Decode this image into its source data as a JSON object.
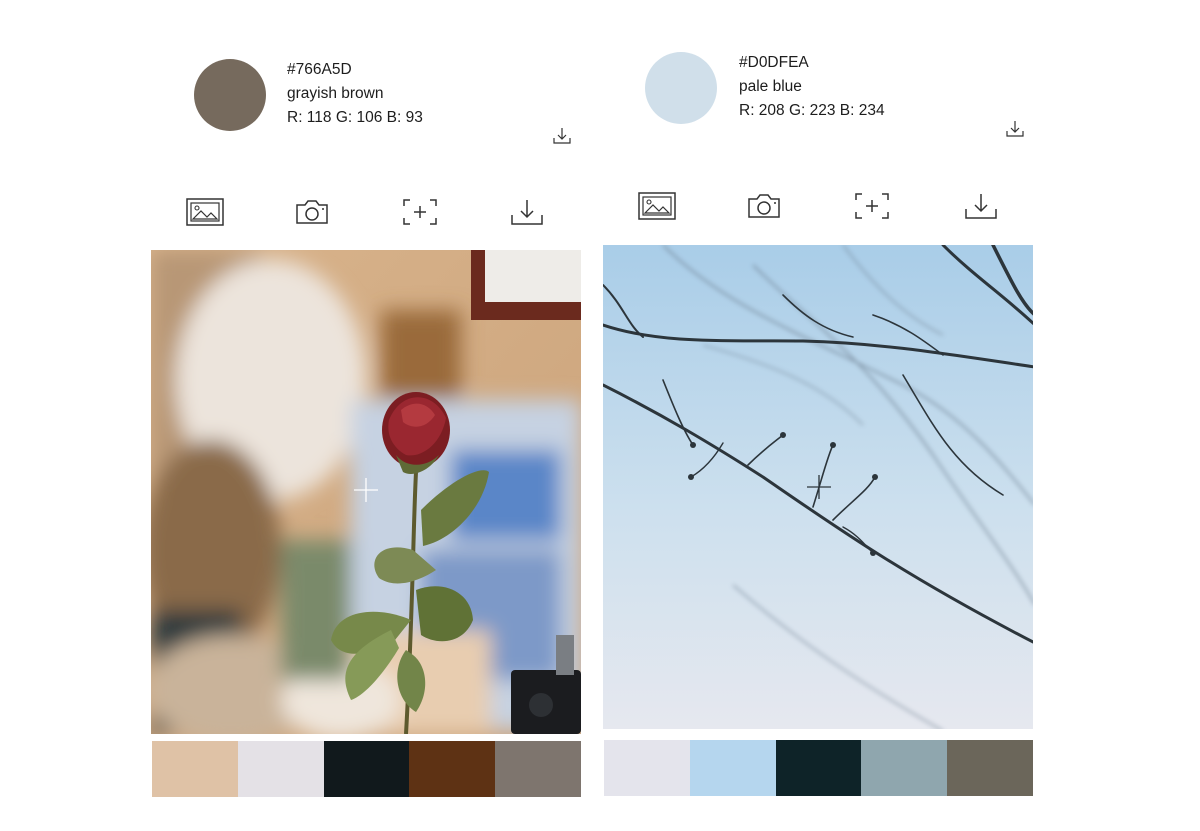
{
  "panels": [
    {
      "id": "left",
      "color": {
        "hex": "#766A5D",
        "name": "grayish brown",
        "rgb": "R: 118 G: 106 B: 93",
        "swatch": "#766A5D"
      },
      "toolbar_icons": [
        "gallery-icon",
        "camera-icon",
        "focus-frame-icon",
        "download-icon"
      ],
      "photo": {
        "subject": "dried rose",
        "picker_icon": "crosshair-icon"
      },
      "palette": [
        "#DFC2A6",
        "#E4E1E6",
        "#11191C",
        "#5E3214",
        "#7E756E"
      ]
    },
    {
      "id": "right",
      "color": {
        "hex": "#D0DFEA",
        "name": "pale blue",
        "rgb": "R: 208 G: 223 B: 234",
        "swatch": "#D0DFEA"
      },
      "toolbar_icons": [
        "gallery-icon",
        "camera-icon",
        "focus-frame-icon",
        "download-icon"
      ],
      "photo": {
        "subject": "bare branches against sky",
        "picker_icon": "crosshair-icon"
      },
      "palette": [
        "#E4E4EC",
        "#B5D6EE",
        "#0E2328",
        "#8FA6AE",
        "#6B665A"
      ]
    }
  ]
}
